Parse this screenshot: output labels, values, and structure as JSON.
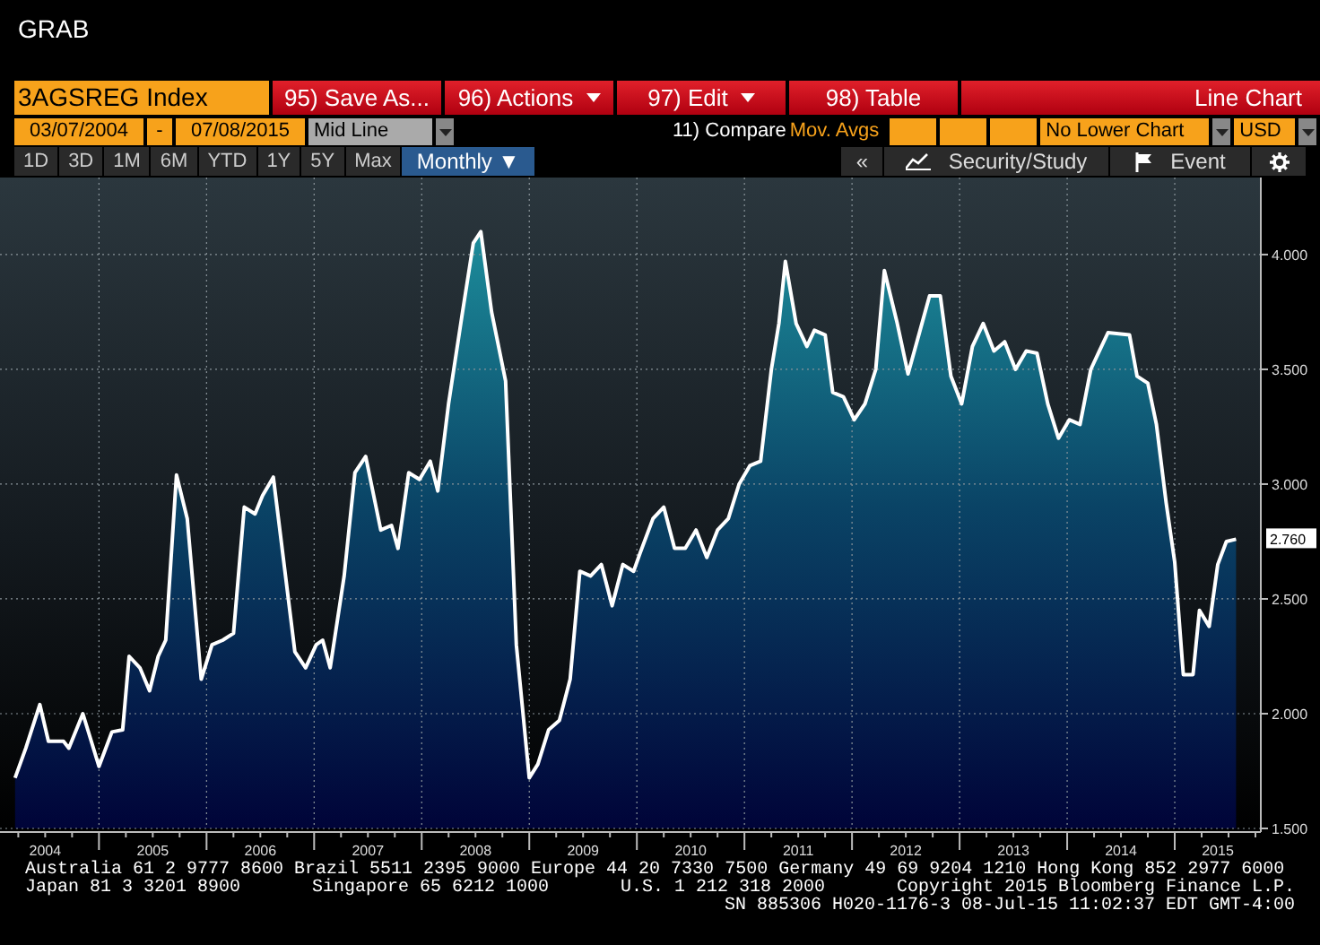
{
  "header": {
    "title": "GRAB"
  },
  "toolbar": {
    "security": "3AGSREG Index",
    "menu": [
      {
        "label": "95) Save As...",
        "caret": false
      },
      {
        "label": "96) Actions",
        "caret": true
      },
      {
        "label": "97) Edit",
        "caret": true
      },
      {
        "label": "98) Table",
        "caret": false
      }
    ],
    "chart_type": "Line Chart"
  },
  "range": {
    "start": "03/07/2004",
    "separator": "-",
    "end": "07/08/2015",
    "price_type": "Mid Line",
    "compare": "11) Compare",
    "mov_avgs": "Mov. Avgs",
    "lower_chart": "No Lower Chart",
    "currency": "USD"
  },
  "periods": [
    {
      "label": "1D",
      "selected": false
    },
    {
      "label": "3D",
      "selected": false
    },
    {
      "label": "1M",
      "selected": false
    },
    {
      "label": "6M",
      "selected": false
    },
    {
      "label": "YTD",
      "selected": false
    },
    {
      "label": "1Y",
      "selected": false
    },
    {
      "label": "5Y",
      "selected": false
    },
    {
      "label": "Max",
      "selected": false
    },
    {
      "label": "Monthly ▼",
      "selected": true
    }
  ],
  "tools": {
    "collapse": "«",
    "study": "Security/Study",
    "event": "Event"
  },
  "chart": {
    "last_value": "2.760",
    "chart_data": {
      "type": "area",
      "grid": true,
      "xlim": [
        2004.08,
        2015.8
      ],
      "ylim": [
        1.5,
        4.32
      ],
      "yticks": [
        {
          "value": 1.5,
          "label": "1.500"
        },
        {
          "value": 2,
          "label": "2.000"
        },
        {
          "value": 2.5,
          "label": "2.500"
        },
        {
          "value": 3,
          "label": "3.000"
        },
        {
          "value": 3.5,
          "label": "3.500"
        },
        {
          "value": 4,
          "label": "4.000"
        }
      ],
      "xticks": [
        {
          "value": 2004.5,
          "label": "2004"
        },
        {
          "value": 2005.5,
          "label": "2005"
        },
        {
          "value": 2006.5,
          "label": "2006"
        },
        {
          "value": 2007.5,
          "label": "2007"
        },
        {
          "value": 2008.5,
          "label": "2008"
        },
        {
          "value": 2009.5,
          "label": "2009"
        },
        {
          "value": 2010.5,
          "label": "2010"
        },
        {
          "value": 2011.5,
          "label": "2011"
        },
        {
          "value": 2012.5,
          "label": "2012"
        },
        {
          "value": 2013.5,
          "label": "2013"
        },
        {
          "value": 2014.5,
          "label": "2014"
        },
        {
          "value": 2015.4,
          "label": "2015"
        }
      ],
      "x": [
        2004.22,
        2004.32,
        2004.45,
        2004.53,
        2004.67,
        2004.72,
        2004.85,
        2005.0,
        2005.12,
        2005.22,
        2005.28,
        2005.38,
        2005.47,
        2005.55,
        2005.62,
        2005.72,
        2005.82,
        2005.95,
        2006.05,
        2006.15,
        2006.25,
        2006.35,
        2006.45,
        2006.52,
        2006.62,
        2006.82,
        2006.92,
        2007.02,
        2007.08,
        2007.15,
        2007.28,
        2007.38,
        2007.48,
        2007.62,
        2007.72,
        2007.78,
        2007.88,
        2007.98,
        2008.08,
        2008.15,
        2008.25,
        2008.38,
        2008.48,
        2008.55,
        2008.65,
        2008.78,
        2008.88,
        2009.0,
        2009.08,
        2009.18,
        2009.28,
        2009.38,
        2009.47,
        2009.57,
        2009.67,
        2009.77,
        2009.87,
        2009.97,
        2010.03,
        2010.15,
        2010.25,
        2010.35,
        2010.45,
        2010.55,
        2010.65,
        2010.75,
        2010.85,
        2010.95,
        2011.05,
        2011.15,
        2011.25,
        2011.32,
        2011.38,
        2011.48,
        2011.58,
        2011.65,
        2011.75,
        2011.82,
        2011.92,
        2012.02,
        2012.12,
        2012.22,
        2012.3,
        2012.42,
        2012.52,
        2012.62,
        2012.72,
        2012.82,
        2012.92,
        2013.02,
        2013.12,
        2013.22,
        2013.32,
        2013.42,
        2013.52,
        2013.62,
        2013.72,
        2013.82,
        2013.92,
        2014.02,
        2014.12,
        2014.22,
        2014.3,
        2014.38,
        2014.58,
        2014.65,
        2014.75,
        2014.83,
        2014.92,
        2015.0,
        2015.08,
        2015.17,
        2015.23,
        2015.32,
        2015.4,
        2015.48,
        2015.57
      ],
      "series": [
        {
          "color": "#ffffff",
          "values": [
            1.72,
            1.85,
            2.04,
            1.88,
            1.88,
            1.85,
            2.0,
            1.77,
            1.92,
            1.93,
            2.25,
            2.2,
            2.1,
            2.25,
            2.32,
            3.04,
            2.85,
            2.15,
            2.3,
            2.32,
            2.35,
            2.9,
            2.87,
            2.95,
            3.03,
            2.27,
            2.2,
            2.3,
            2.32,
            2.2,
            2.6,
            3.05,
            3.12,
            2.8,
            2.82,
            2.72,
            3.05,
            3.02,
            3.1,
            2.97,
            3.35,
            3.75,
            4.05,
            4.1,
            3.75,
            3.45,
            2.3,
            1.72,
            1.78,
            1.93,
            1.97,
            2.15,
            2.62,
            2.6,
            2.65,
            2.47,
            2.65,
            2.62,
            2.7,
            2.85,
            2.9,
            2.72,
            2.72,
            2.8,
            2.68,
            2.8,
            2.85,
            3.0,
            3.08,
            3.1,
            3.5,
            3.7,
            3.97,
            3.7,
            3.6,
            3.67,
            3.65,
            3.4,
            3.38,
            3.28,
            3.35,
            3.5,
            3.93,
            3.7,
            3.48,
            3.65,
            3.82,
            3.82,
            3.47,
            3.35,
            3.6,
            3.7,
            3.58,
            3.62,
            3.5,
            3.58,
            3.57,
            3.35,
            3.2,
            3.28,
            3.26,
            3.5,
            3.58,
            3.66,
            3.65,
            3.47,
            3.44,
            3.26,
            2.92,
            2.66,
            2.17,
            2.17,
            2.45,
            2.38,
            2.65,
            2.75,
            2.76
          ]
        }
      ]
    }
  },
  "footer": {
    "line_1": "Australia 61 2 9777 8600 Brazil 5511 2395 9000 Europe 44 20 7330 7500 Germany 49 69 9204 1210 Hong Kong 852 2977 6000",
    "line_2": [
      "Japan 81 3 3201 8900",
      "Singapore 65 6212 1000",
      "U.S. 1 212 318 2000",
      "Copyright 2015 Bloomberg Finance L.P."
    ],
    "line_3": "SN 885306 H020-1176-3 08-Jul-15 11:02:37 EDT  GMT-4:00"
  }
}
